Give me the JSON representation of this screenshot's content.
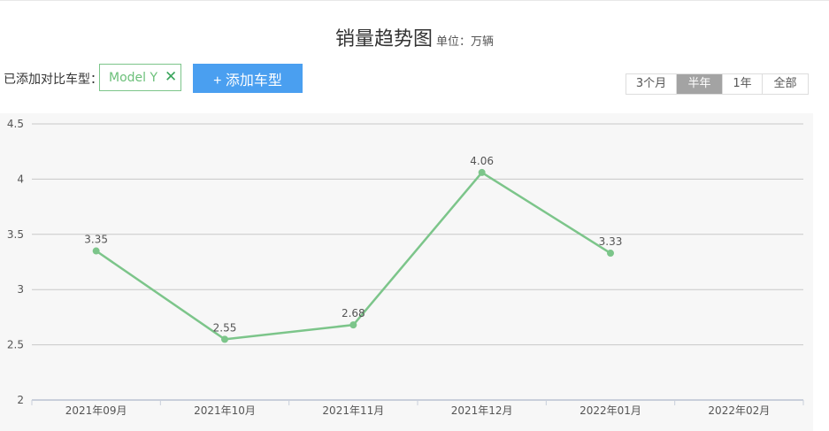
{
  "header": {
    "title": "销量趋势图",
    "unit": "单位：万辆"
  },
  "compare": {
    "label": "已添加对比车型：",
    "model": "Model Y",
    "close_glyph": "✕",
    "add_button": "+ 添加车型"
  },
  "range_tabs": [
    {
      "label": "3个月",
      "active": false
    },
    {
      "label": "半年",
      "active": true
    },
    {
      "label": "1年",
      "active": false
    },
    {
      "label": "全部",
      "active": false
    }
  ],
  "colors": {
    "series": "#7cc58a",
    "accent": "#4a9ff0",
    "active_tab": "#a3a3a3"
  },
  "chart_data": {
    "type": "line",
    "categories": [
      "2021年09月",
      "2021年10月",
      "2021年11月",
      "2021年12月",
      "2022年01月",
      "2022年02月"
    ],
    "series": [
      {
        "values": [
          3.35,
          2.55,
          2.68,
          4.06,
          3.33,
          null
        ]
      }
    ],
    "data_labels": [
      "3.35",
      "2.55",
      "2.68",
      "4.06",
      "3.33",
      ""
    ],
    "yticks": [
      "2",
      "2.5",
      "3",
      "3.5",
      "4",
      "4.5"
    ],
    "ylim": [
      2,
      4.5
    ],
    "grid": true
  }
}
